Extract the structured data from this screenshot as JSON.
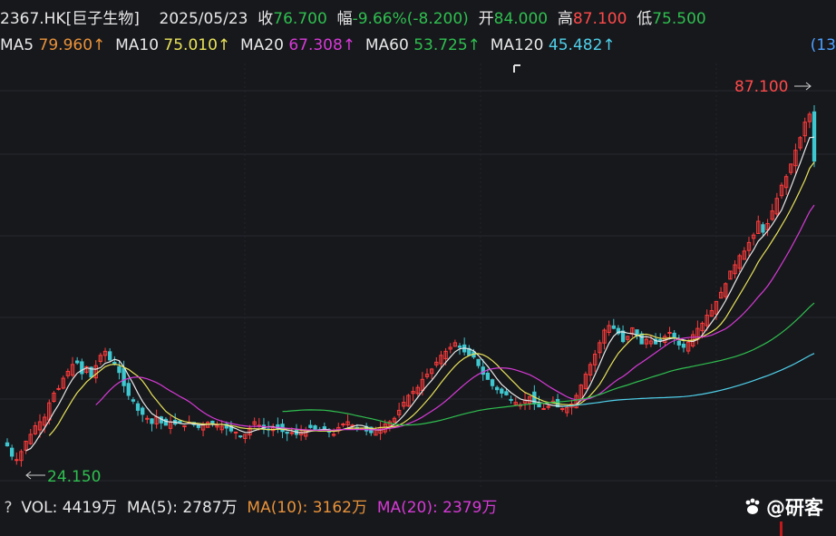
{
  "header": {
    "symbol": "2367.HK[巨子生物]",
    "date": "2025/05/23",
    "close_label": "收",
    "close_value": "76.700",
    "change_label": "幅",
    "change_value": "-9.66%(-8.200)",
    "open_label": "开",
    "open_value": "84.000",
    "high_label": "高",
    "high_value": "87.100",
    "low_label": "低",
    "low_value": "75.500"
  },
  "ma": {
    "ma5_label": "MA5",
    "ma5_value": "79.960↑",
    "ma10_label": "MA10",
    "ma10_value": "75.010↑",
    "ma20_label": "MA20",
    "ma20_value": "67.308↑",
    "ma60_label": "MA60",
    "ma60_value": "53.725↑",
    "ma120_label": "MA120",
    "ma120_value": "45.482↑",
    "scroll_label": "(13"
  },
  "volume": {
    "help": "?",
    "vol_label": "VOL:",
    "vol_value": "4419万",
    "ma5_label": "MA(5):",
    "ma5_value": "2787万",
    "ma10_label": "MA(10):",
    "ma10_value": "3162万",
    "ma20_label": "MA(20):",
    "ma20_value": "2379万"
  },
  "watermark": "@研客",
  "colors": {
    "up": "#ff3b3b",
    "down": "#3fc7d0",
    "ma5": "#e8e8e8",
    "ma10": "#e8e25a",
    "ma20": "#d63ad6",
    "ma60": "#2fbf4f",
    "ma120": "#4fd0ea"
  },
  "chart_data": {
    "type": "candlestick",
    "high_marker": "87.100",
    "low_marker": "24.150",
    "ylim": [
      24.15,
      87.1
    ],
    "closes": [
      27.0,
      25.2,
      24.6,
      26.0,
      27.8,
      29.0,
      30.5,
      31.2,
      32.0,
      34.5,
      36.2,
      37.0,
      38.8,
      40.0,
      41.2,
      41.5,
      39.6,
      40.8,
      39.0,
      41.0,
      42.8,
      43.5,
      42.0,
      41.2,
      39.8,
      37.5,
      35.8,
      34.8,
      33.2,
      32.5,
      31.8,
      30.9,
      32.1,
      31.0,
      30.6,
      31.2,
      30.8,
      31.0,
      30.5,
      31.1,
      30.7,
      30.2,
      30.8,
      31.1,
      30.9,
      30.6,
      30.4,
      30.1,
      29.6,
      29.4,
      28.6,
      29.0,
      30.1,
      31.2,
      30.6,
      30.0,
      29.8,
      30.2,
      30.0,
      29.5,
      29.2,
      29.3,
      29.0,
      29.4,
      29.8,
      30.2,
      29.8,
      29.6,
      30.0,
      29.4,
      29.0,
      30.2,
      30.8,
      31.2,
      30.6,
      30.2,
      30.0,
      29.6,
      29.3,
      29.8,
      30.2,
      30.8,
      31.2,
      31.8,
      33.2,
      34.6,
      35.8,
      36.5,
      37.2,
      38.6,
      39.5,
      40.4,
      41.6,
      42.8,
      43.5,
      44.2,
      45.0,
      44.2,
      43.4,
      42.8,
      42.5,
      41.0,
      39.5,
      38.6,
      37.5,
      36.8,
      36.2,
      35.9,
      35.0,
      34.6,
      34.2,
      35.0,
      35.6,
      34.3,
      33.8,
      33.5,
      33.9,
      34.8,
      33.8,
      33.5,
      33.7,
      34.3,
      35.8,
      37.6,
      39.5,
      41.2,
      43.0,
      45.0,
      47.2,
      48.0,
      47.5,
      46.6,
      45.2,
      46.1,
      47.6,
      46.2,
      44.8,
      45.6,
      45.3,
      44.8,
      45.5,
      46.1,
      46.8,
      45.8,
      44.6,
      44.2,
      45.1,
      46.4,
      47.5,
      48.4,
      49.8,
      50.6,
      52.2,
      53.8,
      55.3,
      57.5,
      58.6,
      60.2,
      61.0,
      62.5,
      63.8,
      66.2,
      64.3,
      65.8,
      68.0,
      70.2,
      72.5,
      74.0,
      76.2,
      78.6,
      80.8,
      83.5,
      84.9,
      76.7
    ],
    "ma_series": [
      "MA5",
      "MA10",
      "MA20",
      "MA60",
      "MA120"
    ]
  }
}
